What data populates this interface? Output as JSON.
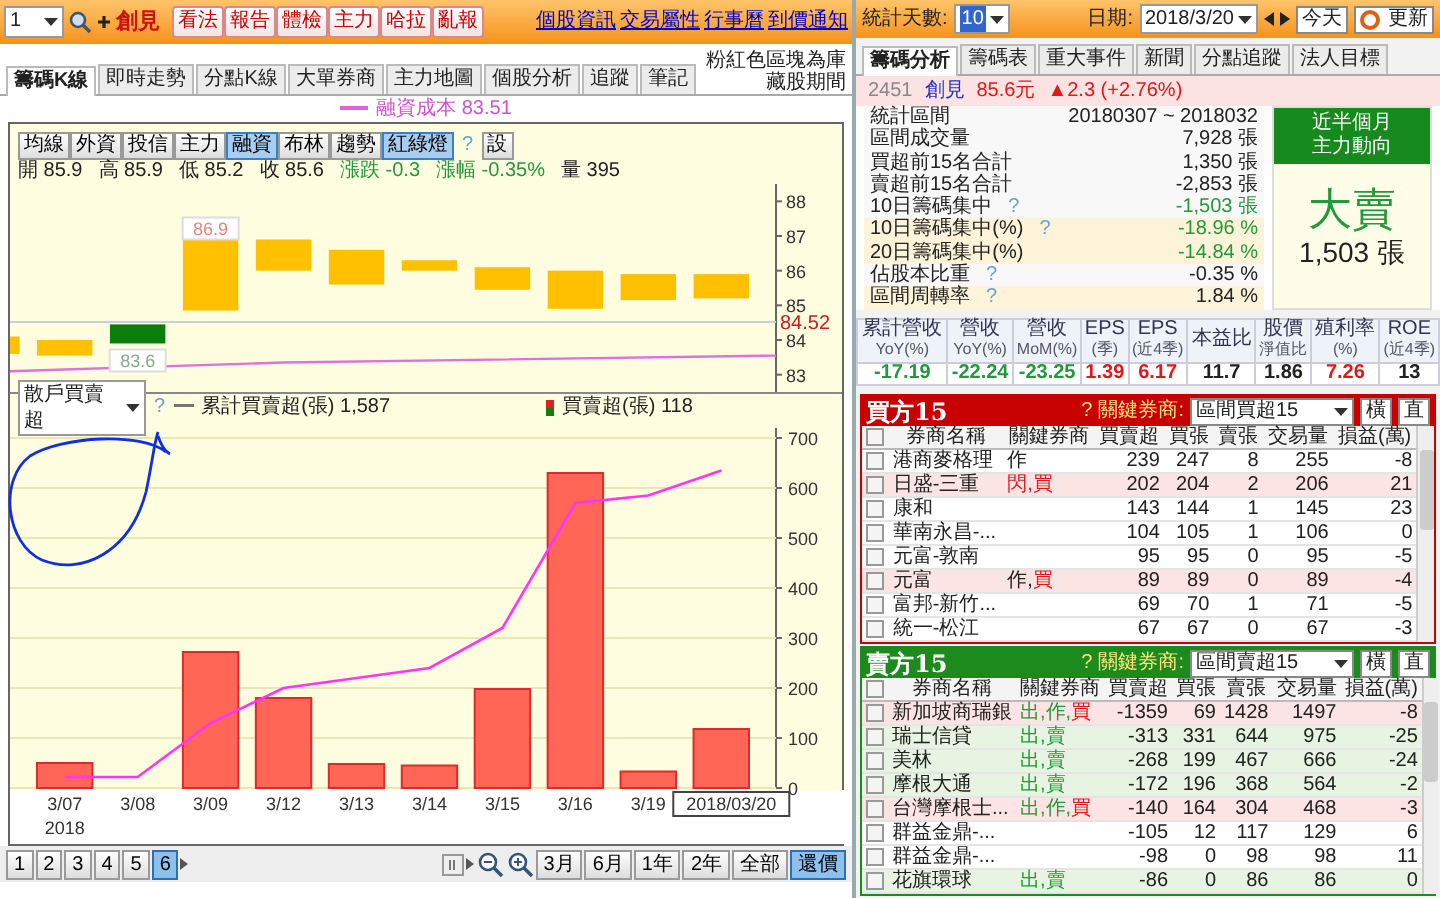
{
  "toolbar": {
    "stock_code": "1",
    "stock_name": "創見",
    "buttons": [
      "看法",
      "報告",
      "體檢",
      "主力",
      "哈拉",
      "亂報"
    ],
    "links": [
      "個股資訊",
      "交易屬性",
      "行事曆",
      "到價通知"
    ]
  },
  "tabs": [
    {
      "label": "籌碼K線",
      "selected": true
    },
    {
      "label": "即時走勢",
      "selected": false
    },
    {
      "label": "分點K線",
      "selected": false
    },
    {
      "label": "大單券商",
      "selected": false
    },
    {
      "label": "主力地圖",
      "selected": false
    },
    {
      "label": "個股分析",
      "selected": false
    },
    {
      "label": "追蹤",
      "selected": false
    },
    {
      "label": "筆記",
      "selected": false
    }
  ],
  "tab_note": "粉紅色區塊為庫藏股期間",
  "price_chart": {
    "legend": "融資成本 83.51",
    "indicator_buttons": [
      {
        "label": "均線",
        "selected": false
      },
      {
        "label": "外資",
        "selected": false
      },
      {
        "label": "投信",
        "selected": false
      },
      {
        "label": "主力",
        "selected": false
      },
      {
        "label": "融資",
        "selected": true
      },
      {
        "label": "布林",
        "selected": false
      },
      {
        "label": "趨勢",
        "selected": false
      },
      {
        "label": "紅綠燈",
        "selected": true
      }
    ],
    "help": "?",
    "settings": "設",
    "ohlc": [
      {
        "text": "開 85.9",
        "kind": "plain"
      },
      {
        "text": "高 85.9",
        "kind": "plain"
      },
      {
        "text": "低 85.2",
        "kind": "plain"
      },
      {
        "text": "收 85.6",
        "kind": "plain"
      },
      {
        "text": "漲跌 -0.3",
        "kind": "down"
      },
      {
        "text": "漲幅 -0.35%",
        "kind": "down"
      },
      {
        "text": "量 395",
        "kind": "plain"
      }
    ],
    "price_axis": [
      "88",
      "87",
      "86",
      "85",
      "84",
      "83"
    ],
    "high_mark": "86.9",
    "low_mark": "83.6",
    "last_price": "84.52"
  },
  "flow_chart": {
    "selector": "散戶買賣超",
    "help": "?",
    "line_total": "1,587",
    "bar_total": "118",
    "year_label": "2018",
    "chart_data": {
      "type": "bar",
      "categories": [
        "3/07",
        "3/08",
        "3/09",
        "3/12",
        "3/13",
        "3/14",
        "3/15",
        "3/16",
        "3/19",
        "2018/03/20"
      ],
      "series": [
        {
          "name": "買賣超(張)",
          "color": "#ff6655",
          "type": "bar",
          "values": [
            50,
            0,
            272,
            180,
            48,
            45,
            198,
            630,
            33,
            118
          ]
        },
        {
          "name": "累計買賣超(張)",
          "color": "#ff33ff",
          "type": "line",
          "values": [
            22,
            22,
            130,
            200,
            220,
            240,
            320,
            570,
            585,
            635
          ]
        }
      ],
      "ylim": [
        0,
        720
      ],
      "grid": true,
      "yticks": [
        0,
        100,
        200,
        300,
        400,
        500,
        600,
        700
      ]
    }
  },
  "bottom_bar": {
    "pages": [
      {
        "label": "1",
        "selected": false
      },
      {
        "label": "2",
        "selected": false
      },
      {
        "label": "3",
        "selected": false
      },
      {
        "label": "4",
        "selected": false
      },
      {
        "label": "5",
        "selected": false
      },
      {
        "label": "6",
        "selected": true
      }
    ],
    "periods": [
      {
        "label": "3月",
        "selected": false
      },
      {
        "label": "6月",
        "selected": false
      },
      {
        "label": "1年",
        "selected": false
      },
      {
        "label": "2年",
        "selected": false
      },
      {
        "label": "全部",
        "selected": false
      },
      {
        "label": "還價",
        "selected": true
      }
    ]
  },
  "right_toolbar": {
    "days_label": "統計天數:",
    "days": "10",
    "date_label": "日期:",
    "date": "2018/3/20",
    "today": "今天",
    "refresh": "更新"
  },
  "right_tabs": [
    {
      "label": "籌碼分析",
      "selected": true
    },
    {
      "label": "籌碼表",
      "selected": false
    },
    {
      "label": "重大事件",
      "selected": false
    },
    {
      "label": "新聞",
      "selected": false
    },
    {
      "label": "分點追蹤",
      "selected": false
    },
    {
      "label": "法人目標",
      "selected": false
    }
  ],
  "quote": {
    "code": "2451",
    "name": "創見",
    "price": "85.6元",
    "change": "▲2.3 (+2.76%)"
  },
  "stats": [
    {
      "label": "統計區間",
      "value": "20180307 ~ 2018032",
      "help": false,
      "shaded": false,
      "kind": "plain"
    },
    {
      "label": "區間成交量",
      "value": "7,928 張",
      "help": false,
      "shaded": false,
      "kind": "plain"
    },
    {
      "label": "買超前15名合計",
      "value": "1,350 張",
      "help": false,
      "shaded": false,
      "kind": "plain"
    },
    {
      "label": "賣超前15名合計",
      "value": "-2,853 張",
      "help": false,
      "shaded": false,
      "kind": "plain"
    },
    {
      "label": "10日籌碼集中",
      "value": "-1,503 張",
      "help": true,
      "shaded": false,
      "kind": "down"
    },
    {
      "label": "10日籌碼集中(%)",
      "value": "-18.96 %",
      "help": true,
      "shaded": true,
      "kind": "down"
    },
    {
      "label": "20日籌碼集中(%)",
      "value": "-14.84 %",
      "help": false,
      "shaded": true,
      "kind": "down"
    },
    {
      "label": "佔股本比重",
      "value": "-0.35 %",
      "help": true,
      "shaded": false,
      "kind": "plain"
    },
    {
      "label": "區間周轉率",
      "value": "1.84 %",
      "help": true,
      "shaded": true,
      "kind": "plain"
    }
  ],
  "help_mark": "?",
  "trend_box": {
    "title": "近半個月",
    "subtitle": "主力動向",
    "verdict": "大賣",
    "amount": "1,503 張"
  },
  "metrics": [
    {
      "label": "累計營收",
      "sub": "YoY(%)",
      "value": "-17.19",
      "kind": "down"
    },
    {
      "label": "營收",
      "sub": "YoY(%)",
      "value": "-22.24",
      "kind": "down"
    },
    {
      "label": "營收",
      "sub": "MoM(%)",
      "value": "-23.25",
      "kind": "down"
    },
    {
      "label": "EPS",
      "sub": "(季)",
      "value": "1.39",
      "kind": "up"
    },
    {
      "label": "EPS",
      "sub": "(近4季)",
      "value": "6.17",
      "kind": "up"
    },
    {
      "label": "本益比",
      "value": "11.7",
      "kind": "plain"
    },
    {
      "label": "股價",
      "sub": "淨值比",
      "value": "1.86",
      "kind": "plain"
    },
    {
      "label": "殖利率",
      "sub": "(%)",
      "value": "7.26",
      "kind": "up"
    },
    {
      "label": "ROE",
      "sub": "(近4季)",
      "value": "13",
      "kind": "plain"
    }
  ],
  "brokers": [
    {
      "kind": "buy",
      "title": "買方15",
      "help": "?",
      "key_label": "關鍵券商:",
      "filter": "區間買超15",
      "buttons": [
        "橫",
        "直"
      ],
      "header_checked": false,
      "columns": [
        "券商名稱",
        "關鍵券商",
        "買賣超",
        "買張",
        "賣張",
        "交易量",
        "損益(萬)"
      ],
      "rows": [
        {
          "checked": false,
          "kind": "plain",
          "cells": [
            "港商麥格理",
            [
              {
                "text": "作",
                "kind": "plain"
              }
            ],
            "239",
            "247",
            "8",
            "255",
            "-8"
          ]
        },
        {
          "checked": false,
          "kind": "pink",
          "cells": [
            "日盛-三重",
            [
              {
                "text": "閃,買",
                "kind": "up"
              }
            ],
            "202",
            "204",
            "2",
            "206",
            "21"
          ]
        },
        {
          "checked": false,
          "kind": "plain",
          "cells": [
            "康和",
            "",
            "143",
            "144",
            "1",
            "145",
            "23"
          ]
        },
        {
          "checked": false,
          "kind": "plain",
          "cells": [
            "華南永昌-...",
            "",
            "104",
            "105",
            "1",
            "106",
            "0"
          ]
        },
        {
          "checked": false,
          "kind": "plain",
          "cells": [
            "元富-敦南",
            "",
            "95",
            "95",
            "0",
            "95",
            "-5"
          ]
        },
        {
          "checked": false,
          "kind": "pink",
          "cells": [
            "元富",
            [
              {
                "text": "作,",
                "kind": "plain"
              },
              {
                "text": "買",
                "kind": "up"
              }
            ],
            "89",
            "89",
            "0",
            "89",
            "-4"
          ]
        },
        {
          "checked": false,
          "kind": "plain",
          "cells": [
            "富邦-新竹...",
            "",
            "69",
            "70",
            "1",
            "71",
            "-5"
          ]
        },
        {
          "checked": false,
          "kind": "plain",
          "cells": [
            "統一-松江",
            "",
            "67",
            "67",
            "0",
            "67",
            "-3"
          ]
        }
      ]
    },
    {
      "kind": "sell",
      "title": "賣方15",
      "help": "?",
      "key_label": "關鍵券商:",
      "filter": "區間賣超15",
      "buttons": [
        "橫",
        "直"
      ],
      "header_checked": false,
      "columns": [
        "券商名稱",
        "關鍵券商",
        "買賣超",
        "買張",
        "賣張",
        "交易量",
        "損益(萬)"
      ],
      "rows": [
        {
          "checked": false,
          "kind": "pink",
          "cells": [
            "新加坡商瑞銀",
            [
              {
                "text": "出,作,",
                "kind": "down"
              },
              {
                "text": "買",
                "kind": "up"
              }
            ],
            "-1359",
            "69",
            "1428",
            "1497",
            "-8"
          ]
        },
        {
          "checked": false,
          "kind": "green",
          "cells": [
            "瑞士信貸",
            [
              {
                "text": "出,賣",
                "kind": "down"
              }
            ],
            "-313",
            "331",
            "644",
            "975",
            "-25"
          ]
        },
        {
          "checked": false,
          "kind": "green",
          "cells": [
            "美林",
            [
              {
                "text": "出,賣",
                "kind": "down"
              }
            ],
            "-268",
            "199",
            "467",
            "666",
            "-24"
          ]
        },
        {
          "checked": false,
          "kind": "green",
          "cells": [
            "摩根大通",
            [
              {
                "text": "出,賣",
                "kind": "down"
              }
            ],
            "-172",
            "196",
            "368",
            "564",
            "-2"
          ]
        },
        {
          "checked": false,
          "kind": "pink",
          "cells": [
            "台灣摩根士...",
            [
              {
                "text": "出,作,",
                "kind": "down"
              },
              {
                "text": "買",
                "kind": "up"
              }
            ],
            "-140",
            "164",
            "304",
            "468",
            "-3"
          ]
        },
        {
          "checked": false,
          "kind": "plain",
          "cells": [
            "群益金鼎-...",
            "",
            "-105",
            "12",
            "117",
            "129",
            "6"
          ]
        },
        {
          "checked": false,
          "kind": "plain",
          "cells": [
            "群益金鼎-...",
            "",
            "-98",
            "0",
            "98",
            "98",
            "11"
          ]
        },
        {
          "checked": false,
          "kind": "green",
          "cells": [
            "花旗環球",
            [
              {
                "text": "出,賣",
                "kind": "down"
              }
            ],
            "-86",
            "0",
            "86",
            "86",
            "0"
          ]
        }
      ]
    }
  ]
}
